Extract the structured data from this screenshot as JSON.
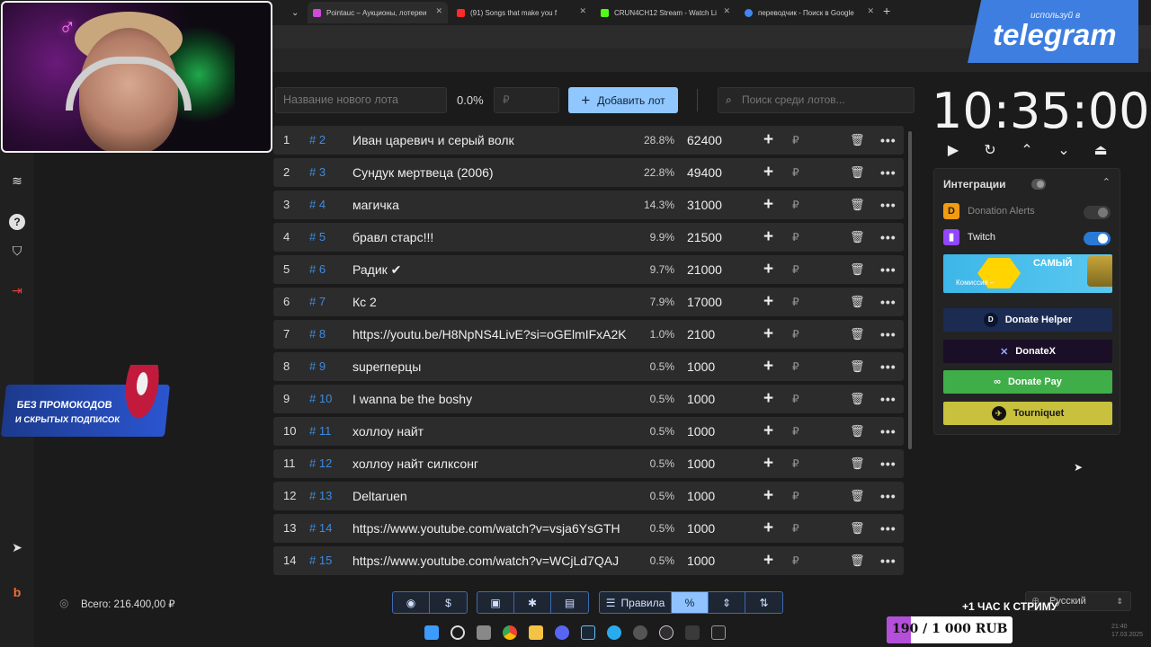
{
  "browser": {
    "tabs": [
      {
        "label": "Pointauc – Аукционы, лотереи",
        "active": true,
        "icon_color": "#d04bd8"
      },
      {
        "label": "(91) Songs that make you f",
        "active": false,
        "icon_color": "#ff2a2a"
      },
      {
        "label": "CRUN4CH12 Stream - Watch Li",
        "active": false,
        "icon_color": "#53fc18"
      },
      {
        "label": "переводчик - Поиск в Google",
        "active": false,
        "icon_color": "#4285f4"
      }
    ]
  },
  "toolbar": {
    "new_lot_placeholder": "Название нового лота",
    "percent": "0.0%",
    "amount_placeholder": "₽",
    "add_button": "Добавить лот",
    "search_placeholder": "Поиск среди лотов..."
  },
  "lots": [
    {
      "index": "1",
      "id": "# 2",
      "name": "Иван царевич и серый волк",
      "pct": "28.8%",
      "amount": "62400"
    },
    {
      "index": "2",
      "id": "# 3",
      "name": "Сундук мертвеца (2006)",
      "pct": "22.8%",
      "amount": "49400"
    },
    {
      "index": "3",
      "id": "# 4",
      "name": "магичка",
      "pct": "14.3%",
      "amount": "31000"
    },
    {
      "index": "4",
      "id": "# 5",
      "name": "бравл старс!!!",
      "pct": "9.9%",
      "amount": "21500"
    },
    {
      "index": "5",
      "id": "# 6",
      "name": "Радик ✔",
      "pct": "9.7%",
      "amount": "21000"
    },
    {
      "index": "6",
      "id": "# 7",
      "name": "Кс 2",
      "pct": "7.9%",
      "amount": "17000"
    },
    {
      "index": "7",
      "id": "# 8",
      "name": "https://youtu.be/H8NpNS4LivE?si=oGElmIFxA2K",
      "pct": "1.0%",
      "amount": "2100"
    },
    {
      "index": "8",
      "id": "# 9",
      "name": "superперцы",
      "pct": "0.5%",
      "amount": "1000"
    },
    {
      "index": "9",
      "id": "# 10",
      "name": "I wanna be the boshy",
      "pct": "0.5%",
      "amount": "1000"
    },
    {
      "index": "10",
      "id": "# 11",
      "name": "холлоу найт",
      "pct": "0.5%",
      "amount": "1000"
    },
    {
      "index": "11",
      "id": "# 12",
      "name": "холлоу найт силксонг",
      "pct": "0.5%",
      "amount": "1000"
    },
    {
      "index": "12",
      "id": "# 13",
      "name": "Deltaruen",
      "pct": "0.5%",
      "amount": "1000"
    },
    {
      "index": "13",
      "id": "# 14",
      "name": "https://www.youtube.com/watch?v=vsja6YsGTH",
      "pct": "0.5%",
      "amount": "1000"
    },
    {
      "index": "14",
      "id": "# 15",
      "name": "https://www.youtube.com/watch?v=WCjLd7QAJ",
      "pct": "0.5%",
      "amount": "1000"
    }
  ],
  "row_icons": {
    "plus": "+",
    "rub": "₽",
    "delete": "🗑",
    "more": "•••"
  },
  "footer": {
    "total": "Всего: 216.400,00 ₽",
    "rules_label": "Правила",
    "percent_label": "%"
  },
  "timer": {
    "value": "10:35:00"
  },
  "integrations": {
    "title": "Интеграции",
    "services": [
      {
        "name": "Donation Alerts",
        "enabled": false,
        "color": "#f39c12"
      },
      {
        "name": "Twitch",
        "enabled": true,
        "color": "#9146ff"
      }
    ],
    "banner": {
      "line1": "САМЫЙ",
      "line2": "Комиссия –"
    },
    "pay_buttons": [
      {
        "label": "Donate Helper",
        "bg": "#1b2b52",
        "fg": "#ffffff"
      },
      {
        "label": "DonateX",
        "bg": "#1a0f26",
        "fg": "#ffffff"
      },
      {
        "label": "Donate Pay",
        "bg": "#3fae49",
        "fg": "#ffffff"
      },
      {
        "label": "Tourniquet",
        "bg": "#c8c13e",
        "fg": "#1a1a1a"
      }
    ]
  },
  "overlays": {
    "telegram_small": "используй в",
    "telegram_big": "telegram",
    "promo_line1": "БЕЗ ПРОМОКОДОВ",
    "promo_line2": "И СКРЫТЫХ ПОДПИСОК",
    "hour_to_stream": "+1 ЧАС К СТРИМУ",
    "language": "Русский",
    "donation_goal": "190 / 1 000 RUB",
    "donation_progress": 0.19,
    "tray_time": "21:40",
    "tray_date": "17.03.2025"
  }
}
